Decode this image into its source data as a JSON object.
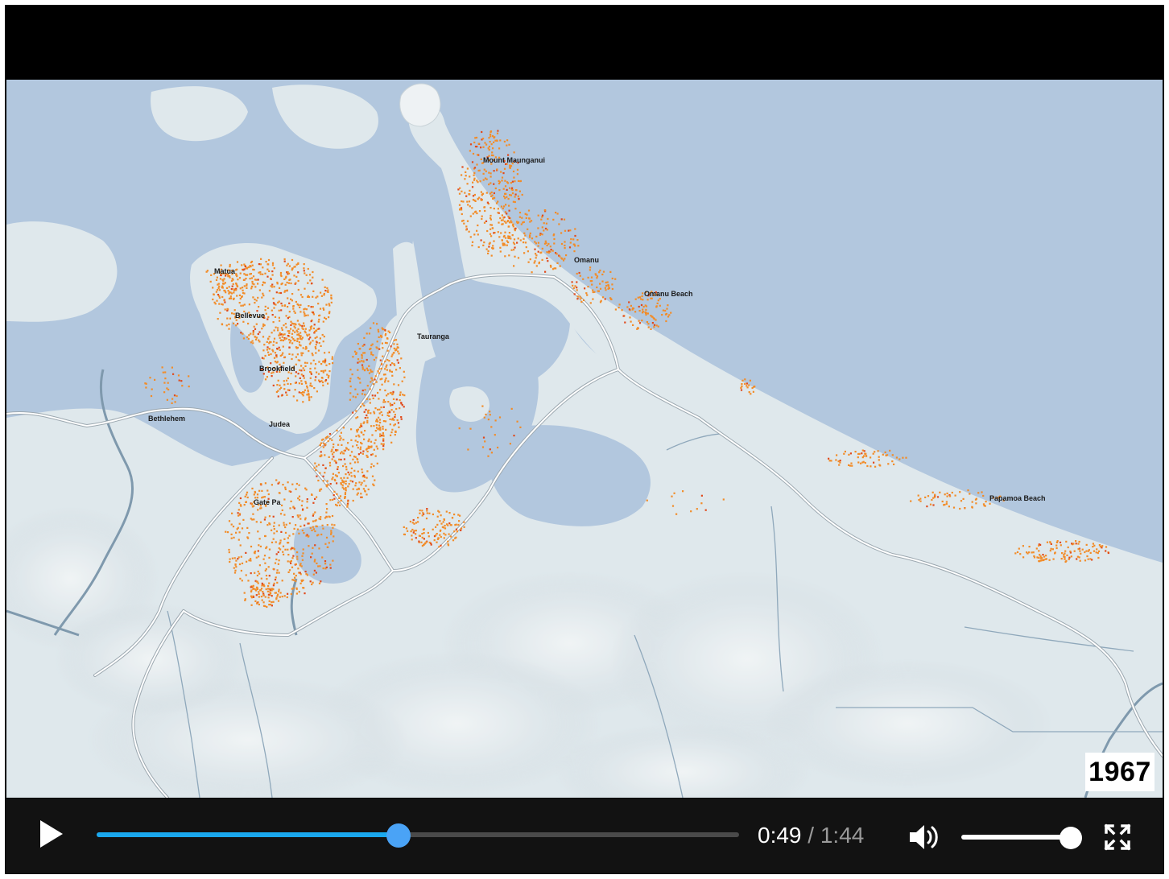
{
  "video": {
    "year": "1967",
    "map_labels": [
      {
        "id": "mount-maunganui",
        "text": "Mount Maunganui"
      },
      {
        "id": "omanu",
        "text": "Omanu"
      },
      {
        "id": "omanu-beach",
        "text": "Omanu Beach"
      },
      {
        "id": "matua",
        "text": "Matua"
      },
      {
        "id": "bellevue",
        "text": "Bellevue"
      },
      {
        "id": "tauranga",
        "text": "Tauranga"
      },
      {
        "id": "brookfield",
        "text": "Brookfield"
      },
      {
        "id": "bethlehem",
        "text": "Bethlehem"
      },
      {
        "id": "judea",
        "text": "Judea"
      },
      {
        "id": "gate-pa",
        "text": "Gate Pa"
      },
      {
        "id": "papamoa-beach",
        "text": "Papamoa Beach"
      }
    ],
    "colors": {
      "sea": "#b2c7de",
      "land": "#dfe8ec",
      "settlement": "#f28c28",
      "settlement_dense": "#e04a1c",
      "road": "#ffffff",
      "river": "#7f99ad"
    }
  },
  "controls": {
    "play_icon": "play-icon",
    "current_time": "0:49",
    "separator": "/",
    "duration": "1:44",
    "progress_fraction": 0.47,
    "volume_icon": "volume-icon",
    "volume_fraction": 1.0,
    "fullscreen_icon": "fullscreen-icon",
    "accent_color": "#1aa8ee"
  }
}
